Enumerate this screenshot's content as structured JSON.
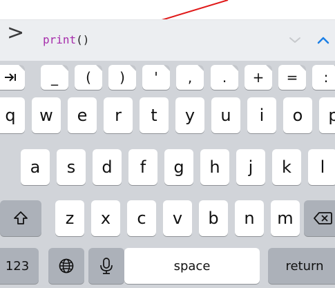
{
  "topbar": {
    "prompt": ">",
    "code_fn": "print",
    "code_parens": "()"
  },
  "icons": {
    "chevron_down": "chevron-down-icon",
    "chevron_up": "chevron-up-icon",
    "shift": "shift-icon",
    "backspace": "backspace-icon",
    "globe": "globe-icon",
    "mic": "microphone-icon",
    "tab": "tab-icon"
  },
  "colors": {
    "accent": "#1b7fe6",
    "annotation_arrow": "#e01919",
    "function_name": "#a62cab",
    "keyboard_bg": "#d1d4d9"
  },
  "symbol_row": [
    "_",
    "(",
    ")",
    "'",
    ",",
    ".",
    "+",
    "=",
    ":"
  ],
  "row1": [
    "q",
    "w",
    "e",
    "r",
    "t",
    "y",
    "u",
    "i",
    "o",
    "p"
  ],
  "row2": [
    "a",
    "s",
    "d",
    "f",
    "g",
    "h",
    "j",
    "k",
    "l"
  ],
  "row3": [
    "z",
    "x",
    "c",
    "v",
    "b",
    "n",
    "m"
  ],
  "bottom": {
    "numbers_label": "123",
    "space_label": "space",
    "return_label": "return"
  }
}
